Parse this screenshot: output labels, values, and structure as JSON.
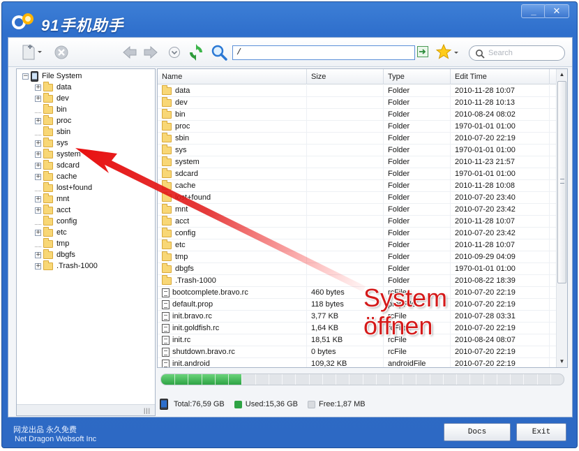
{
  "app": {
    "title": "91手机助手"
  },
  "window_controls": {
    "minimize": "_",
    "close": "✕"
  },
  "toolbar": {
    "path_value": "/",
    "search_placeholder": "Search"
  },
  "tree": {
    "root": "File System",
    "items": [
      {
        "label": "data",
        "expandable": true
      },
      {
        "label": "dev",
        "expandable": true
      },
      {
        "label": "bin",
        "expandable": false
      },
      {
        "label": "proc",
        "expandable": true
      },
      {
        "label": "sbin",
        "expandable": false
      },
      {
        "label": "sys",
        "expandable": true
      },
      {
        "label": "system",
        "expandable": true
      },
      {
        "label": "sdcard",
        "expandable": true
      },
      {
        "label": "cache",
        "expandable": true
      },
      {
        "label": "lost+found",
        "expandable": false
      },
      {
        "label": "mnt",
        "expandable": true
      },
      {
        "label": "acct",
        "expandable": true
      },
      {
        "label": "config",
        "expandable": false
      },
      {
        "label": "etc",
        "expandable": true
      },
      {
        "label": "tmp",
        "expandable": false
      },
      {
        "label": "dbgfs",
        "expandable": true
      },
      {
        "label": ".Trash-1000",
        "expandable": true
      }
    ]
  },
  "table": {
    "columns": [
      "Name",
      "Size",
      "Type",
      "Edit Time"
    ],
    "rows": [
      {
        "icon": "folder",
        "name": "data",
        "size": "",
        "type": "Folder",
        "time": "2010-11-28 10:07"
      },
      {
        "icon": "folder",
        "name": "dev",
        "size": "",
        "type": "Folder",
        "time": "2010-11-28 10:13"
      },
      {
        "icon": "folder",
        "name": "bin",
        "size": "",
        "type": "Folder",
        "time": "2010-08-24 08:02"
      },
      {
        "icon": "folder",
        "name": "proc",
        "size": "",
        "type": "Folder",
        "time": "1970-01-01 01:00"
      },
      {
        "icon": "folder",
        "name": "sbin",
        "size": "",
        "type": "Folder",
        "time": "2010-07-20 22:19"
      },
      {
        "icon": "folder",
        "name": "sys",
        "size": "",
        "type": "Folder",
        "time": "1970-01-01 01:00"
      },
      {
        "icon": "folder",
        "name": "system",
        "size": "",
        "type": "Folder",
        "time": "2010-11-23 21:57"
      },
      {
        "icon": "folder",
        "name": "sdcard",
        "size": "",
        "type": "Folder",
        "time": "1970-01-01 01:00"
      },
      {
        "icon": "folder",
        "name": "cache",
        "size": "",
        "type": "Folder",
        "time": "2010-11-28 10:08"
      },
      {
        "icon": "folder",
        "name": "lost+found",
        "size": "",
        "type": "Folder",
        "time": "2010-07-20 23:40"
      },
      {
        "icon": "folder",
        "name": "mnt",
        "size": "",
        "type": "Folder",
        "time": "2010-07-20 23:42"
      },
      {
        "icon": "folder",
        "name": "acct",
        "size": "",
        "type": "Folder",
        "time": "2010-11-28 10:07"
      },
      {
        "icon": "folder",
        "name": "config",
        "size": "",
        "type": "Folder",
        "time": "2010-07-20 23:42"
      },
      {
        "icon": "folder",
        "name": "etc",
        "size": "",
        "type": "Folder",
        "time": "2010-11-28 10:07"
      },
      {
        "icon": "folder",
        "name": "tmp",
        "size": "",
        "type": "Folder",
        "time": "2010-09-29 04:09"
      },
      {
        "icon": "folder",
        "name": "dbgfs",
        "size": "",
        "type": "Folder",
        "time": "1970-01-01 01:00"
      },
      {
        "icon": "folder",
        "name": ".Trash-1000",
        "size": "",
        "type": "Folder",
        "time": "2010-08-22 18:39"
      },
      {
        "icon": "file",
        "name": "bootcomplete.bravo.rc",
        "size": "460 bytes",
        "type": "rcFile",
        "time": "2010-07-20 22:19"
      },
      {
        "icon": "file",
        "name": "default.prop",
        "size": "118 bytes",
        "type": "propFile",
        "time": "2010-07-20 22:19"
      },
      {
        "icon": "file",
        "name": "init.bravo.rc",
        "size": "3,77 KB",
        "type": "rcFile",
        "time": "2010-07-28 03:31"
      },
      {
        "icon": "file",
        "name": "init.goldfish.rc",
        "size": "1,64 KB",
        "type": "rcFile",
        "time": "2010-07-20 22:19"
      },
      {
        "icon": "file",
        "name": "init.rc",
        "size": "18,51 KB",
        "type": "rcFile",
        "time": "2010-08-24 08:07"
      },
      {
        "icon": "file",
        "name": "shutdown.bravo.rc",
        "size": "0 bytes",
        "type": "rcFile",
        "time": "2010-07-20 22:19"
      },
      {
        "icon": "file",
        "name": "init.android",
        "size": "109,32 KB",
        "type": "androidFile",
        "time": "2010-07-20 22:19"
      }
    ]
  },
  "storage": {
    "used_fraction": 0.2,
    "total": "Total:76,59 GB",
    "used": "Used:15,36 GB",
    "free": "Free:1,87 MB",
    "used_color": "#2ea344",
    "free_color": "#d8dbdf"
  },
  "footer": {
    "line1": "网龙出品 永久免费",
    "line2": "Net Dragon Websoft Inc",
    "docs_label": "Docs",
    "exit_label": "Exit"
  },
  "annotation": {
    "line1": "System",
    "line2": "öffnen",
    "color": "#d41a1a"
  }
}
